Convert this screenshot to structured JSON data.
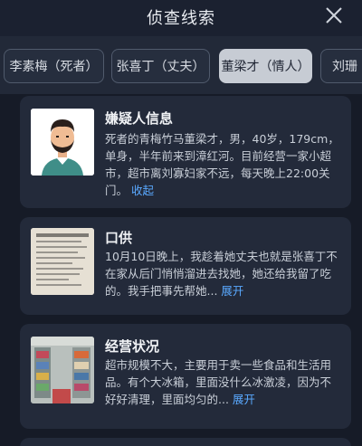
{
  "header": {
    "title": "侦查线索"
  },
  "tabs": [
    {
      "label": "李素梅（死者）",
      "active": false
    },
    {
      "label": "张喜丁（丈夫）",
      "active": false
    },
    {
      "label": "董梁才（情人）",
      "active": true
    },
    {
      "label": "刘珊",
      "active": false
    }
  ],
  "cards": [
    {
      "title": "嫌疑人信息",
      "body": "死者的青梅竹马董梁才，男，40岁，179cm，单身，半年前来到漳红河。目前经营一家小超市，超市离刘寡妇家不远，每天晚上22:00关门。",
      "link": "收起",
      "thumb_icon": "suspect-avatar-icon"
    },
    {
      "title": "口供",
      "body": "10月10日晚上，我趁着她丈夫也就是张喜丁不在家从后门悄悄溜进去找她，她还给我留了吃的。我手把事先帮她...",
      "link": "展开",
      "thumb_icon": "document-photo-icon"
    },
    {
      "title": "经营状况",
      "body": "超市规模不大，主要用于卖一些食品和生活用品。有个大冰箱，里面没什么冰激凌，因为不好好清理，里面均匀的...",
      "link": "展开",
      "thumb_icon": "store-photo-icon"
    }
  ],
  "colors": {
    "background": "#1b2130",
    "card": "#232a3a",
    "active_tab": "#c7ccd4",
    "link": "#5aa9ff"
  }
}
